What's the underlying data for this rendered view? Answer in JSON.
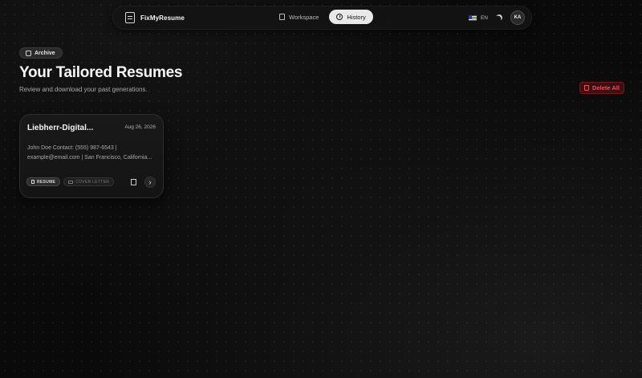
{
  "nav": {
    "brand": "FixMyResume",
    "tabs": [
      {
        "label": "Workspace",
        "icon": "document-icon",
        "active": false
      },
      {
        "label": "History",
        "icon": "clock-icon",
        "active": true
      }
    ],
    "language": "EN",
    "avatar_initials": "KA"
  },
  "header": {
    "badge": "Archive",
    "title": "Your Tailored Resumes",
    "subtitle": "Review and download your past generations.",
    "delete_all_label": "Delete All"
  },
  "cards": [
    {
      "title": "Liebherr-Digital...",
      "date": "Aug 26, 2026",
      "preview_line1": "John Doe Contact: (555) 987-6543 |",
      "preview_line2": "example@email.com | San Francisco, California...",
      "chip_resume": "RESUME",
      "chip_cover": "COVER LETTER"
    }
  ],
  "colors": {
    "background": "#0a0a0a",
    "danger": "#ef4d5a",
    "active_tab": "#e9e9e9"
  }
}
